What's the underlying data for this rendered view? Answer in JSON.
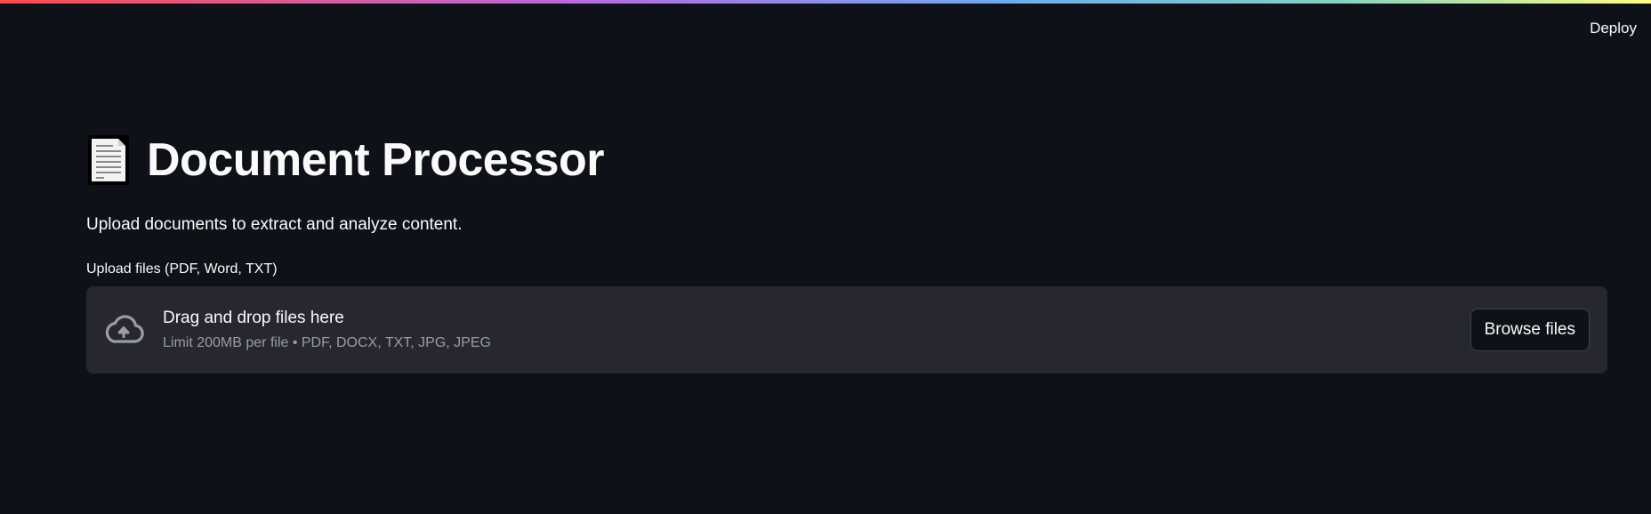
{
  "header": {
    "deploy_label": "Deploy"
  },
  "main": {
    "title": "Document Processor",
    "title_icon": "page-facing-up-icon",
    "subtitle": "Upload documents to extract and analyze content.",
    "uploader": {
      "label": "Upload files (PDF, Word, TXT)",
      "drop_text": "Drag and drop files here",
      "limit_text": "Limit 200MB per file • PDF, DOCX, TXT, JPG, JPEG",
      "browse_label": "Browse files",
      "icon": "cloud-upload-icon"
    }
  },
  "colors": {
    "background": "#0e1117",
    "dropzone": "#262730",
    "text": "#fafafa",
    "muted_text": "#9a9ba3"
  }
}
